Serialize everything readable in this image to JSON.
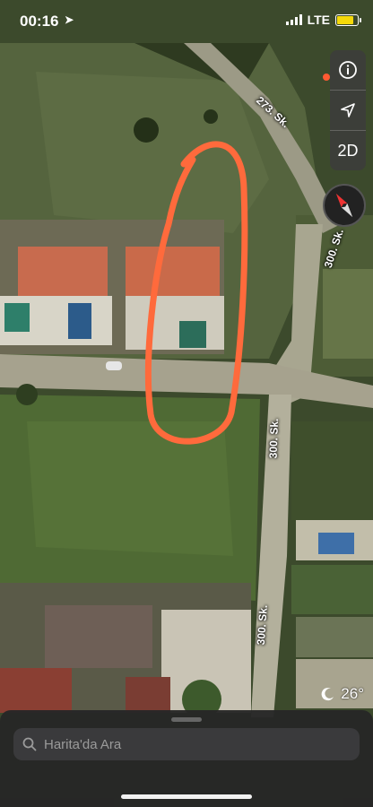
{
  "status_bar": {
    "time": "00:16",
    "network": "LTE"
  },
  "map_controls": {
    "view_mode": "2D"
  },
  "streets": [
    "273. Sk.",
    "300. Sk.",
    "300. Sk.",
    "300. Sk."
  ],
  "weather": {
    "temperature": "26°"
  },
  "search": {
    "placeholder": "Harita'da Ara"
  },
  "colors": {
    "annotation": "#ff6a3c",
    "location_dot": "#ff5a32",
    "battery": "#f5d90a"
  },
  "icons": [
    "location-arrow-icon",
    "signal-icon",
    "battery-icon",
    "info-icon",
    "navigation-arrow-icon",
    "compass-icon",
    "moon-icon",
    "search-icon"
  ]
}
